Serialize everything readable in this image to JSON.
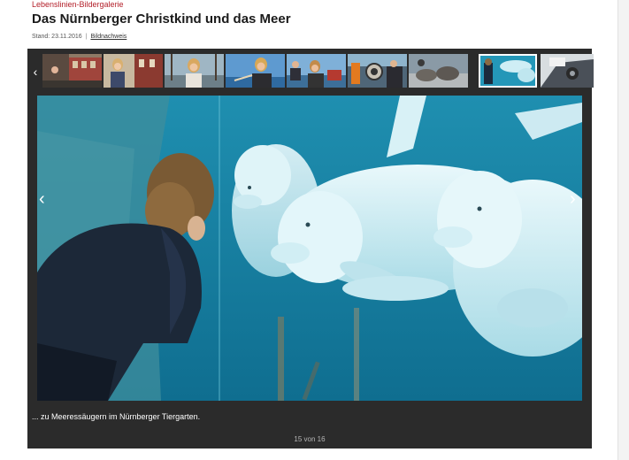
{
  "header": {
    "kicker": "Lebenslinien-Bildergalerie",
    "title": "Das Nürnberger Christkind und das Meer",
    "date": "Stand: 23.11.2016",
    "separator": "|",
    "credit_link": "Bildnachweis"
  },
  "gallery": {
    "thumb_prev_icon": "chevron-left-icon",
    "thumbnails": [
      {
        "subject": "street scene"
      },
      {
        "subject": "woman in street"
      },
      {
        "subject": "woman at harbor"
      },
      {
        "subject": "woman at sea"
      },
      {
        "subject": "people on boat"
      },
      {
        "subject": "people on deck"
      },
      {
        "subject": "diver portrait"
      },
      {
        "subject": "seals"
      },
      {
        "subject": "dolphins",
        "active": true
      },
      {
        "subject": "car interior"
      }
    ],
    "prev_icon": "chevron-left-icon",
    "next_icon": "chevron-right-icon",
    "main_image_subject": "woman watching beluga whales through aquarium glass",
    "caption": "... zu Meeressäugern im Nürnberger Tiergarten.",
    "counter": "15 von 16"
  },
  "colors": {
    "kicker": "#b3202a",
    "gallery_bg": "#2b2b2b",
    "water": "#1f95b5"
  }
}
